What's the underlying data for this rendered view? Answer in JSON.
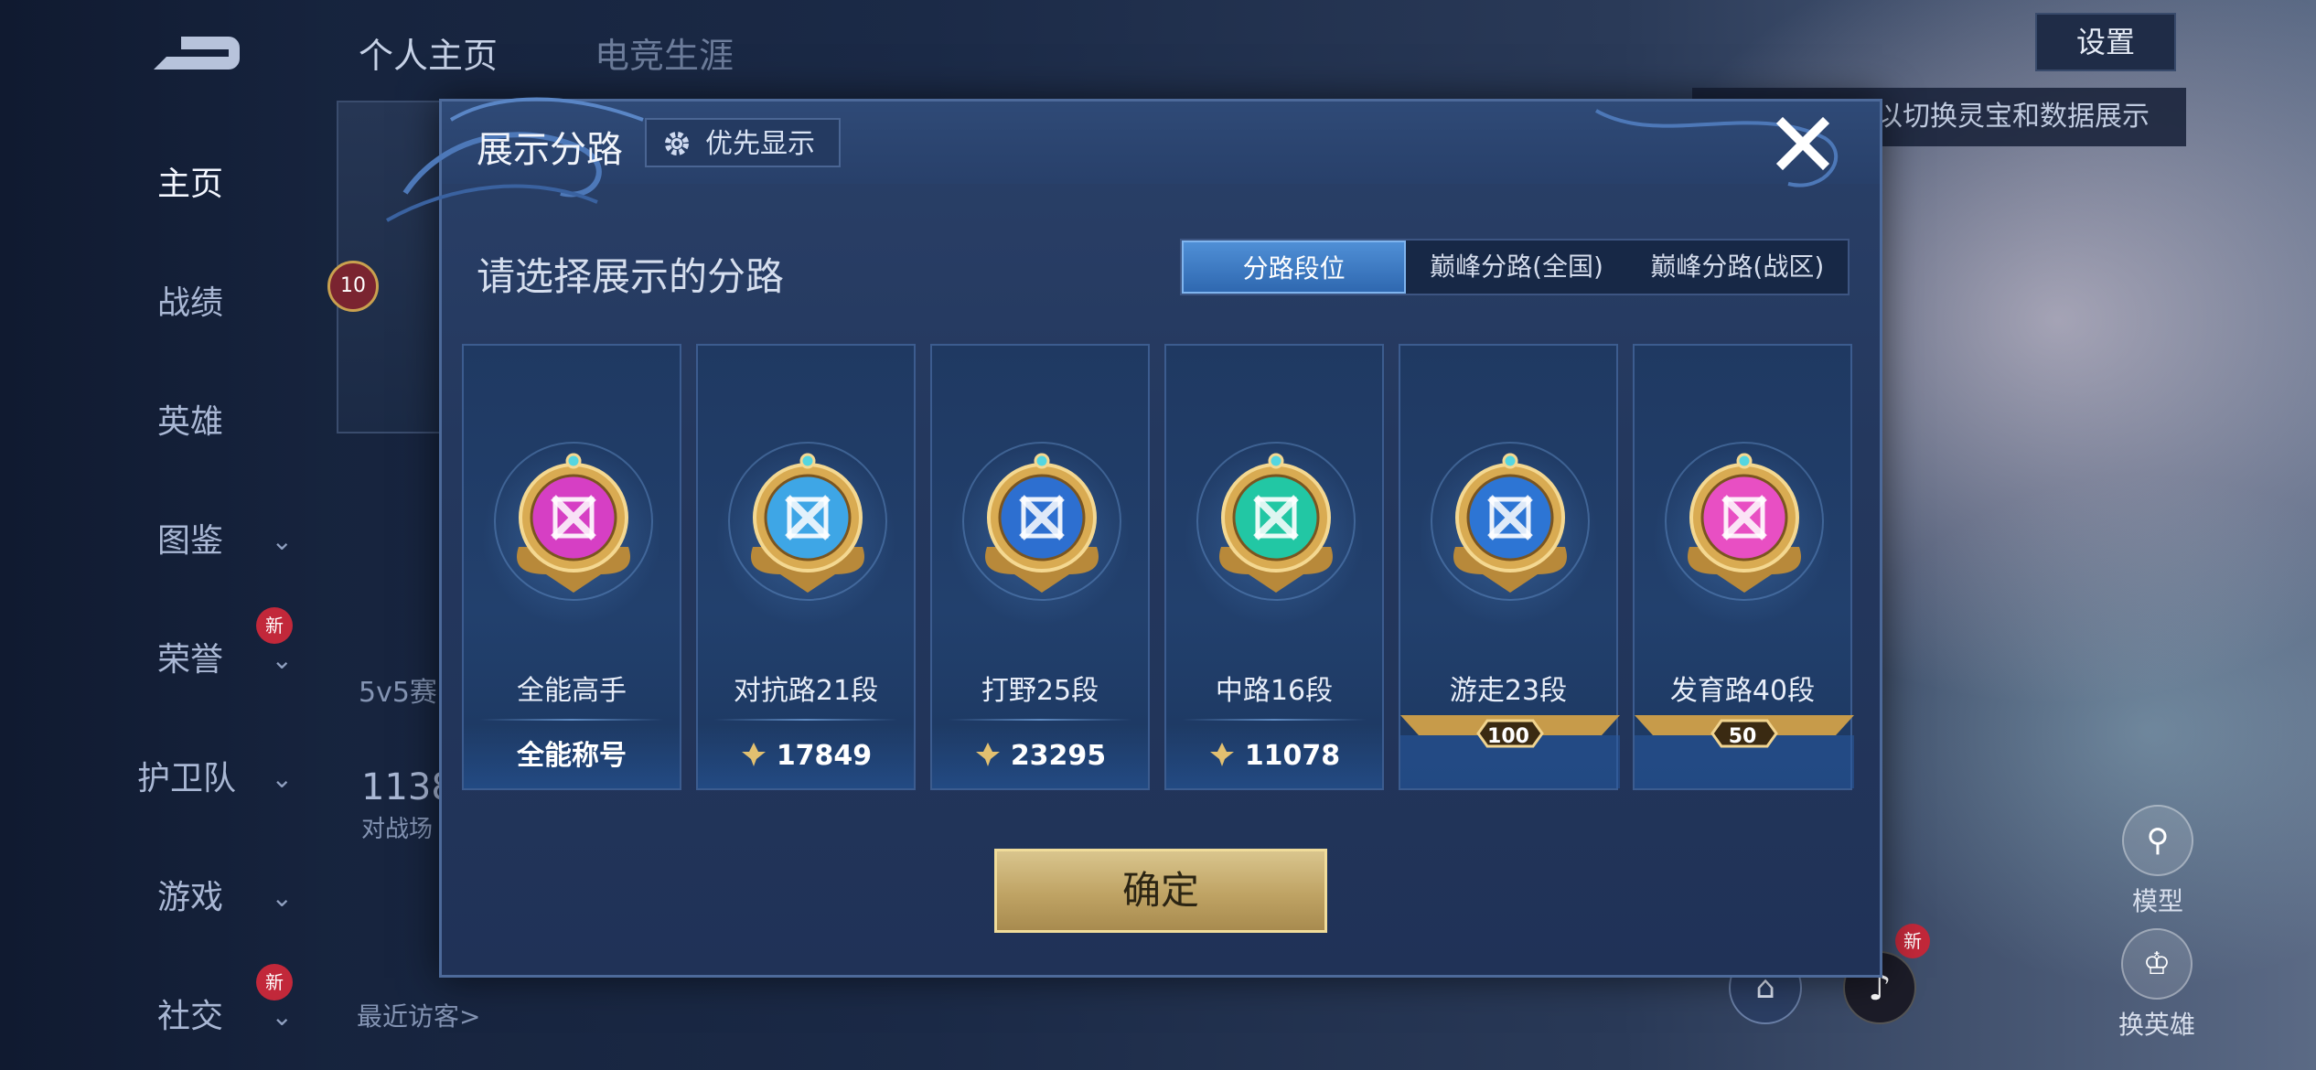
{
  "background": {
    "top_tabs": [
      "个人主页",
      "电竞生涯"
    ],
    "settings_label": "设置",
    "hint_text": "以切换灵宝和数据展示",
    "nav": [
      {
        "label": "主页",
        "active": true,
        "chevron": false,
        "badge": ""
      },
      {
        "label": "战绩",
        "active": false,
        "chevron": false,
        "badge": ""
      },
      {
        "label": "英雄",
        "active": false,
        "chevron": false,
        "badge": ""
      },
      {
        "label": "图鉴",
        "active": false,
        "chevron": true,
        "badge": ""
      },
      {
        "label": "荣誉",
        "active": false,
        "chevron": true,
        "badge": "新"
      },
      {
        "label": "护卫队",
        "active": false,
        "chevron": true,
        "badge": ""
      },
      {
        "label": "游戏",
        "active": false,
        "chevron": true,
        "badge": ""
      },
      {
        "label": "社交",
        "active": false,
        "chevron": true,
        "badge": "新"
      }
    ],
    "level_badge": "10",
    "mode_text": "5v5赛",
    "count_value": "1138",
    "count_label": "对战场",
    "recent_visitors": "最近访客>",
    "right_buttons": [
      "模型",
      "换英雄"
    ],
    "tiktok_badge": "新"
  },
  "dialog": {
    "title": "展示分路",
    "priority_button": "优先显示",
    "prompt": "请选择展示的分路",
    "tabs": [
      {
        "label": "分路段位",
        "active": true
      },
      {
        "label": "巅峰分路(全国)",
        "active": false
      },
      {
        "label": "巅峰分路(战区)",
        "active": false
      }
    ],
    "cards": [
      {
        "name": "全能高手",
        "bottom": "全能称号",
        "type": "title",
        "color": "#d63fc4",
        "icon": "all-round-icon"
      },
      {
        "name": "对抗路21段",
        "bottom": "17849",
        "type": "points",
        "color": "#3ea6e6",
        "icon": "clash-lane-icon"
      },
      {
        "name": "打野25段",
        "bottom": "23295",
        "type": "points",
        "color": "#2d6fd0",
        "icon": "jungle-icon"
      },
      {
        "name": "中路16段",
        "bottom": "11078",
        "type": "points",
        "color": "#22c7a4",
        "icon": "mid-lane-icon"
      },
      {
        "name": "游走23段",
        "bottom": "100",
        "type": "rank",
        "color": "#2d75d4",
        "icon": "roam-icon"
      },
      {
        "name": "发育路40段",
        "bottom": "50",
        "type": "rank",
        "color": "#e84fc3",
        "icon": "farm-lane-icon"
      }
    ],
    "confirm": "确定"
  }
}
